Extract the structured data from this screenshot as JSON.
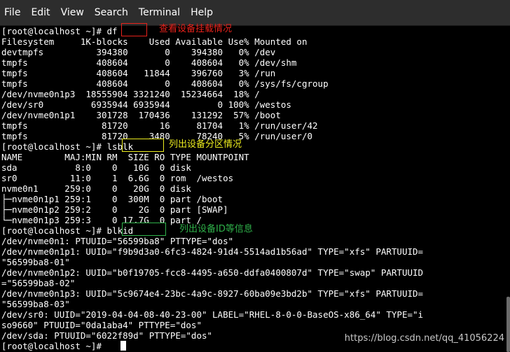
{
  "menu": {
    "items": [
      "File",
      "Edit",
      "View",
      "Search",
      "Terminal",
      "Help"
    ]
  },
  "terminal": {
    "lines": [
      "[root@localhost ~]# df",
      "Filesystem     1K-blocks    Used Available Use% Mounted on",
      "devtmpfs          394380       0    394380   0% /dev",
      "tmpfs             408604       0    408604   0% /dev/shm",
      "tmpfs             408604   11844    396760   3% /run",
      "tmpfs             408604       0    408604   0% /sys/fs/cgroup",
      "/dev/nvme0n1p3  18555904 3321240  15234664  18% /",
      "/dev/sr0         6935944 6935944         0 100% /westos",
      "/dev/nvme0n1p1    301728  170436    131292  57% /boot",
      "tmpfs              81720      16     81704   1% /run/user/42",
      "tmpfs              81720    3480     78240   5% /run/user/0",
      "[root@localhost ~]# lsblk",
      "NAME        MAJ:MIN RM  SIZE RO TYPE MOUNTPOINT",
      "sda           8:0    0   10G  0 disk",
      "sr0          11:0    1  6.6G  0 rom  /westos",
      "nvme0n1     259:0    0   20G  0 disk",
      "├─nvme0n1p1 259:1    0  300M  0 part /boot",
      "├─nvme0n1p2 259:2    0    2G  0 part [SWAP]",
      "└─nvme0n1p3 259:3    0 17.7G  0 part /",
      "[root@localhost ~]# blkid",
      "/dev/nvme0n1: PTUUID=\"56599ba8\" PTTYPE=\"dos\"",
      "/dev/nvme0n1p1: UUID=\"f9b9d3a0-6fc3-4824-91d4-5514ad1b56ad\" TYPE=\"xfs\" PARTUUID=",
      "\"56599ba8-01\"",
      "/dev/nvme0n1p2: UUID=\"b0f19705-fcc8-4495-a650-ddfa0400807d\" TYPE=\"swap\" PARTUUID",
      "=\"56599ba8-02\"",
      "/dev/nvme0n1p3: UUID=\"5c9674e4-23bc-4a9c-8927-60ba09e3bd2b\" TYPE=\"xfs\" PARTUUID=",
      "\"56599ba8-03\"",
      "/dev/sr0: UUID=\"2019-04-04-08-40-23-00\" LABEL=\"RHEL-8-0-0-BaseOS-x86_64\" TYPE=\"i",
      "so9660\" PTUUID=\"0da1aba4\" PTTYPE=\"dos\"",
      "/dev/sda: PTUUID=\"6022f89d\" PTTYPE=\"dos\"",
      "[root@localhost ~]#"
    ]
  },
  "annotations": {
    "df": "查看设备挂载情况",
    "lsblk": "列出设备分区情况",
    "blkid": "列出设备ID等信息"
  },
  "watermark": "https://blog.csdn.net/qq_41056224",
  "colors": {
    "background": "#000000",
    "menubar": "#2d2d2d",
    "text": "#ffffff",
    "annotation_red": "#e8221b",
    "annotation_yellow": "#ecec1e",
    "annotation_green": "#2fb24a"
  }
}
